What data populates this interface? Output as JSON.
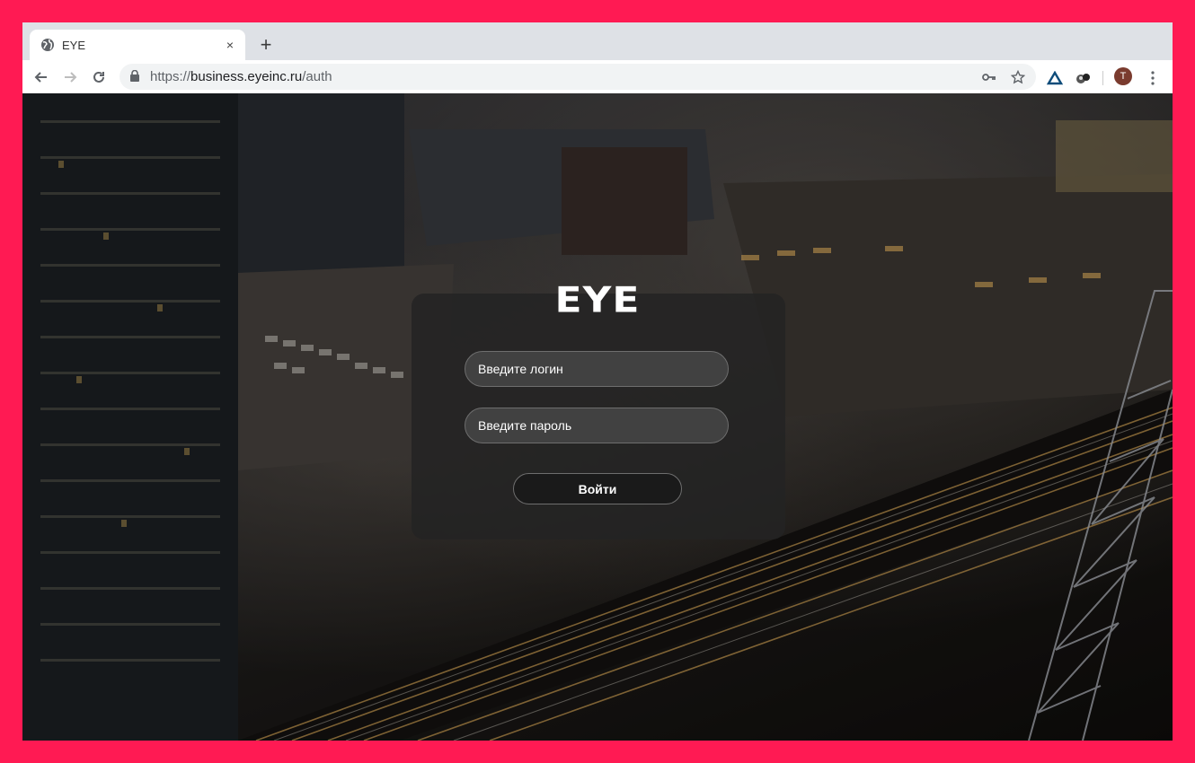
{
  "browser": {
    "tab_title": "EYE",
    "new_tab_glyph": "+",
    "close_glyph": "×",
    "url_scheme": "https://",
    "url_host": "business.eyeinc.ru",
    "url_path": "/auth",
    "profile_initial": "T"
  },
  "page": {
    "logo_text": "EYE",
    "login_placeholder": "Введите логин",
    "password_placeholder": "Введите пароль",
    "submit_label": "Войти"
  },
  "colors": {
    "frame": "#ff1a53",
    "card": "#232323",
    "text": "#ffffff"
  }
}
